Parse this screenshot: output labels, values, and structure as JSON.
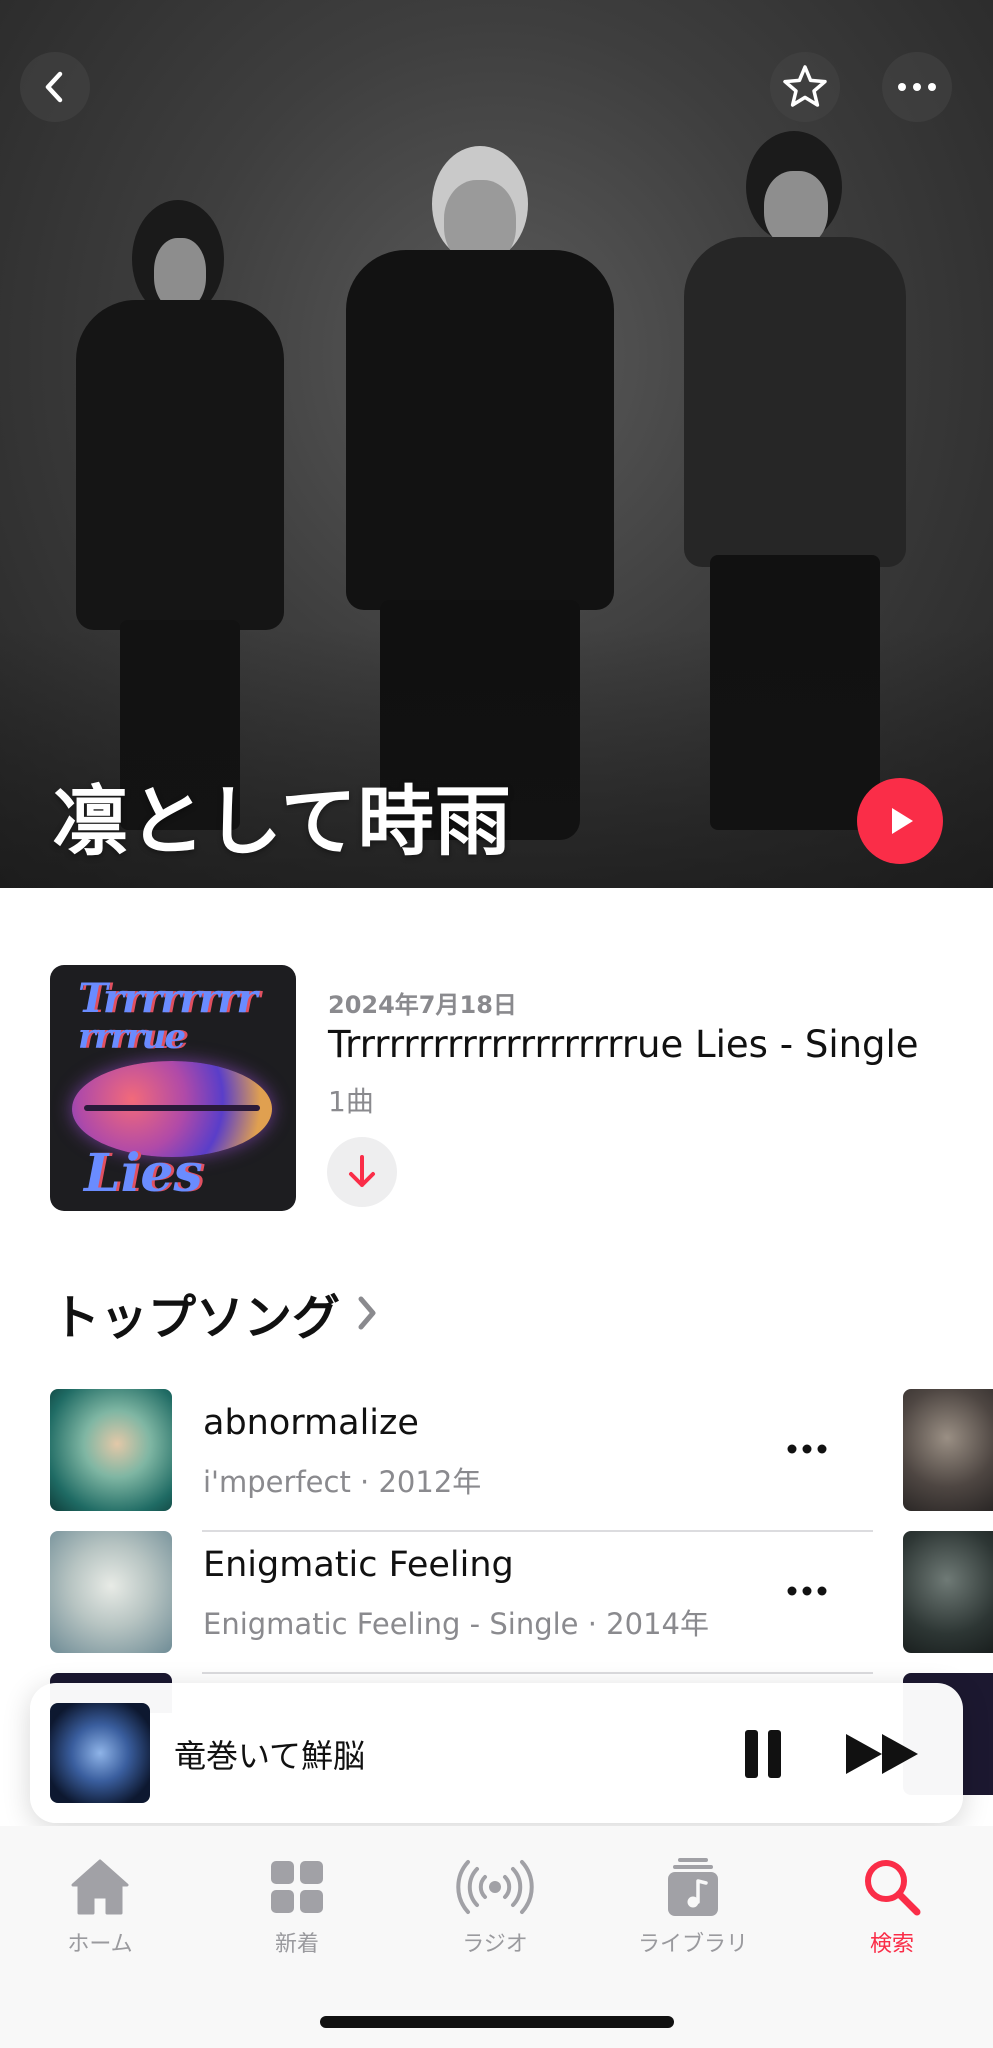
{
  "artist": {
    "name": "凛として時雨"
  },
  "header": {
    "back_icon": "chevron-left-icon",
    "favorite_icon": "star-icon",
    "more_icon": "ellipsis-icon",
    "play_icon": "play-icon"
  },
  "latest_release": {
    "date": "2024年7月18日",
    "title": "Trrrrrrrrrrrrrrrrrrrrue Lies - Single",
    "track_count": "1曲",
    "artwork_text_line1": "Trrrrrrrr",
    "artwork_text_line2": "rrrrue",
    "artwork_text_line3": "Lies",
    "download_icon": "arrow-down-icon"
  },
  "top_songs": {
    "title": "トップソング",
    "chevron_icon": "chevron-right-icon",
    "songs": [
      {
        "title": "abnormalize",
        "subtitle": "i'mperfect · 2012年"
      },
      {
        "title": "Enigmatic Feeling",
        "subtitle": "Enigmatic Feeling - Single · 2014年"
      }
    ]
  },
  "mini_player": {
    "title": "竜巻いて鮮脳",
    "pause_icon": "pause-icon",
    "next_icon": "forward-icon"
  },
  "tab_bar": {
    "tabs": [
      {
        "label": "ホーム",
        "icon": "home-icon"
      },
      {
        "label": "新着",
        "icon": "grid-icon"
      },
      {
        "label": "ラジオ",
        "icon": "radio-icon"
      },
      {
        "label": "ライブラリ",
        "icon": "library-icon"
      },
      {
        "label": "検索",
        "icon": "search-icon"
      }
    ],
    "active_tab": "検索"
  },
  "colors": {
    "accent": "#fa2d48",
    "secondary_text": "#8a8a8e"
  }
}
